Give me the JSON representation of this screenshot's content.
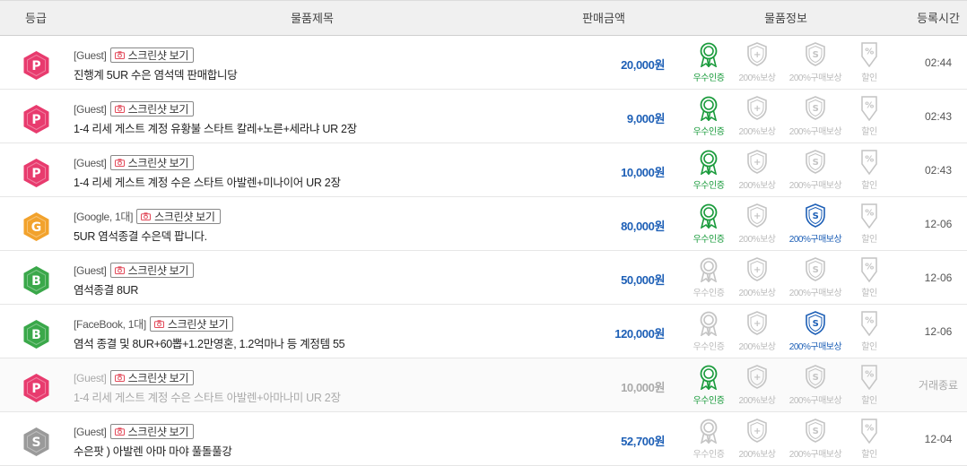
{
  "header": {
    "grade": "등급",
    "title": "물품제목",
    "price": "판매금액",
    "info": "물품정보",
    "time": "등록시간"
  },
  "colors": {
    "grade_P": "#e83b6e",
    "grade_G": "#f2a22c",
    "grade_B": "#3aa84a",
    "grade_S": "#9a9a9a",
    "price": "#1d5fb6",
    "cert_on": "#1a9b3c",
    "buy_on": "#1d5fb6",
    "inactive": "#bbbbbb"
  },
  "badge_labels": {
    "cert": "우수인증",
    "comp": "200%보상",
    "buy": "200%구매보상",
    "disc": "할인"
  },
  "screenshot_label": "스크린샷 보기",
  "rows": [
    {
      "grade": "P",
      "account": "[Guest]",
      "title": "진행계 5UR 수은 염석덱 판매합니당",
      "price": "20,000원",
      "cert": true,
      "buy": false,
      "time": "02:44",
      "closed": false
    },
    {
      "grade": "P",
      "account": "[Guest]",
      "title": "1-4 리세 게스트 계정 유황불 스타트 칼레+노른+세라냐 UR 2장",
      "price": "9,000원",
      "cert": true,
      "buy": false,
      "time": "02:43",
      "closed": false
    },
    {
      "grade": "P",
      "account": "[Guest]",
      "title": "1-4 리세 게스트 계정 수은 스타트 아발렌+미나이어 UR 2장",
      "price": "10,000원",
      "cert": true,
      "buy": false,
      "time": "02:43",
      "closed": false
    },
    {
      "grade": "G",
      "account": "[Google, 1대]",
      "title": "5UR 염석종결 수은덱 팝니다.",
      "price": "80,000원",
      "cert": true,
      "buy": true,
      "time": "12-06",
      "closed": false
    },
    {
      "grade": "B",
      "account": "[Guest]",
      "title": "염석종결 8UR",
      "price": "50,000원",
      "cert": false,
      "buy": false,
      "time": "12-06",
      "closed": false
    },
    {
      "grade": "B",
      "account": "[FaceBook, 1대]",
      "title": "염석 종결 및 8UR+60뽑+1.2만영혼, 1.2억마나 등 계정템 55",
      "price": "120,000원",
      "cert": false,
      "buy": true,
      "time": "12-06",
      "closed": false
    },
    {
      "grade": "P",
      "account": "[Guest]",
      "title": "1-4 리세 게스트 계정 수은 스타트 아발렌+아마나미 UR 2장",
      "price": "10,000원",
      "cert": true,
      "buy": false,
      "time": "거래종료",
      "closed": true
    },
    {
      "grade": "S",
      "account": "[Guest]",
      "title": "수은팟 ) 아발렌 아마 마야 풀돌풀강",
      "price": "52,700원",
      "cert": false,
      "buy": false,
      "time": "12-04",
      "closed": false
    }
  ]
}
